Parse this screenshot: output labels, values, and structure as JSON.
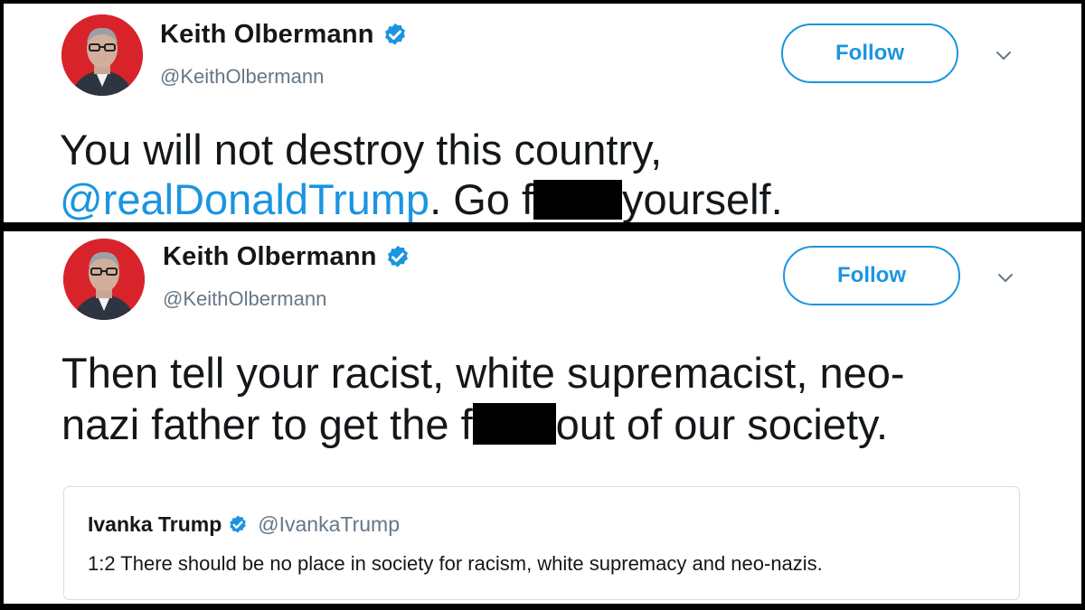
{
  "tweets": [
    {
      "author": {
        "display_name": "Keith Olbermann",
        "handle": "@KeithOlbermann",
        "verified": true
      },
      "follow_label": "Follow",
      "text": {
        "line1": "You will not destroy this country,",
        "mention": "@realDonaldTrump",
        "after_mention": ". Go f",
        "after_redaction": "yourself."
      }
    },
    {
      "author": {
        "display_name": "Keith Olbermann",
        "handle": "@KeithOlbermann",
        "verified": true
      },
      "follow_label": "Follow",
      "text": {
        "line1": "Then tell your racist, white supremacist, neo-",
        "line2_before_redaction": "nazi father to get the f",
        "line2_after_redaction": "out of our society."
      },
      "quoted_tweet": {
        "display_name": "Ivanka Trump",
        "handle": "@IvankaTrump",
        "verified": true,
        "text": "1:2 There should be no place in society for racism, white supremacy and neo-nazis."
      }
    }
  ],
  "icons": {
    "verified": "verified-badge-icon",
    "chevron": "chevron-down-icon"
  },
  "colors": {
    "twitter_blue": "#1b95e0",
    "text": "#14171a",
    "muted": "#657786",
    "avatar_bg": "#d8232a",
    "redaction": "#000000"
  }
}
